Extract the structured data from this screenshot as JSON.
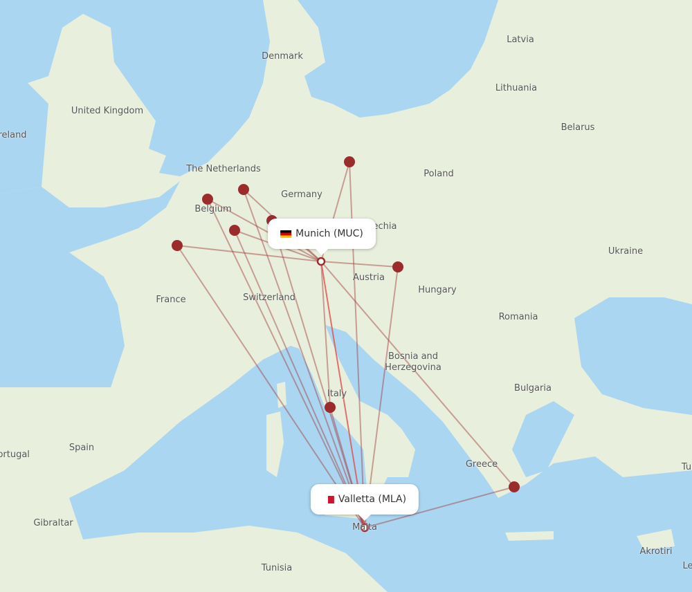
{
  "origin": {
    "name": "Munich (MUC)",
    "flag": "germany-flag"
  },
  "destination": {
    "name": "Valletta (MLA)",
    "flag": "malta-flag"
  },
  "colors": {
    "water": "#aad6f2",
    "land": "#e8efdc",
    "route": "#a03a3a",
    "dot": "#9b2c2c",
    "main_route": "#e05050"
  },
  "country_labels": [
    "Denmark",
    "Latvia",
    "Lithuania",
    "United Kingdom",
    "reland",
    "Belarus",
    "The Netherlands",
    "Poland",
    "Germany",
    "Belgium",
    "Czechia",
    "Ukraine",
    "Austria",
    "France",
    "Hungary",
    "Switzerland",
    "Romania",
    "Bosnia and Herzegovina",
    "Bulgaria",
    "Italy",
    "Spain",
    "Portugal",
    "Greece",
    "Gibraltar",
    "Malta",
    "Tunisia",
    "Akrotiri",
    "Tu",
    "Le"
  ]
}
